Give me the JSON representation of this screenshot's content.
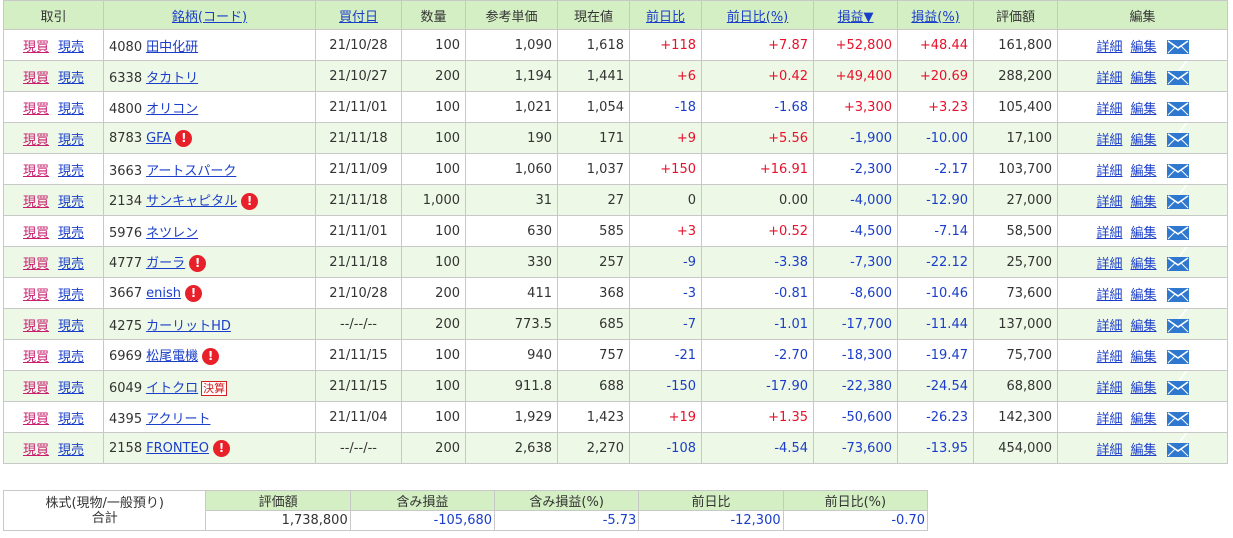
{
  "headers": {
    "trade": "取引",
    "stock": "銘柄(コード)",
    "buy_date": "買付日",
    "qty": "数量",
    "ref_price": "参考単価",
    "current": "現在値",
    "day_change": "前日比",
    "day_change_pct": "前日比(%)",
    "pl": "損益▼",
    "pl_pct": "損益(%)",
    "valuation": "評価額",
    "edit": "編集"
  },
  "labels": {
    "buy": "現買",
    "sell": "現売",
    "detail": "詳細",
    "edit": "編集",
    "alert": "!"
  },
  "rows": [
    {
      "code": "4080",
      "name": "田中化研",
      "alert": false,
      "badge": "",
      "date": "21/10/28",
      "qty": "100",
      "ref": "1,090",
      "cur": "1,618",
      "chg": "+118",
      "chg_pct": "+7.87",
      "pl": "+52,800",
      "pl_pct": "+48.44",
      "val": "161,800"
    },
    {
      "code": "6338",
      "name": "タカトリ",
      "alert": false,
      "badge": "",
      "date": "21/10/27",
      "qty": "200",
      "ref": "1,194",
      "cur": "1,441",
      "chg": "+6",
      "chg_pct": "+0.42",
      "pl": "+49,400",
      "pl_pct": "+20.69",
      "val": "288,200"
    },
    {
      "code": "4800",
      "name": "オリコン",
      "alert": false,
      "badge": "",
      "date": "21/11/01",
      "qty": "100",
      "ref": "1,021",
      "cur": "1,054",
      "chg": "-18",
      "chg_pct": "-1.68",
      "pl": "+3,300",
      "pl_pct": "+3.23",
      "val": "105,400"
    },
    {
      "code": "8783",
      "name": "GFA",
      "alert": true,
      "badge": "",
      "date": "21/11/18",
      "qty": "100",
      "ref": "190",
      "cur": "171",
      "chg": "+9",
      "chg_pct": "+5.56",
      "pl": "-1,900",
      "pl_pct": "-10.00",
      "val": "17,100"
    },
    {
      "code": "3663",
      "name": "アートスパーク",
      "alert": false,
      "badge": "",
      "date": "21/11/09",
      "qty": "100",
      "ref": "1,060",
      "cur": "1,037",
      "chg": "+150",
      "chg_pct": "+16.91",
      "pl": "-2,300",
      "pl_pct": "-2.17",
      "val": "103,700"
    },
    {
      "code": "2134",
      "name": "サンキャピタル",
      "alert": true,
      "badge": "",
      "date": "21/11/18",
      "qty": "1,000",
      "ref": "31",
      "cur": "27",
      "chg": "0",
      "chg_pct": "0.00",
      "pl": "-4,000",
      "pl_pct": "-12.90",
      "val": "27,000"
    },
    {
      "code": "5976",
      "name": "ネツレン",
      "alert": false,
      "badge": "",
      "date": "21/11/01",
      "qty": "100",
      "ref": "630",
      "cur": "585",
      "chg": "+3",
      "chg_pct": "+0.52",
      "pl": "-4,500",
      "pl_pct": "-7.14",
      "val": "58,500"
    },
    {
      "code": "4777",
      "name": "ガーラ",
      "alert": true,
      "badge": "",
      "date": "21/11/18",
      "qty": "100",
      "ref": "330",
      "cur": "257",
      "chg": "-9",
      "chg_pct": "-3.38",
      "pl": "-7,300",
      "pl_pct": "-22.12",
      "val": "25,700"
    },
    {
      "code": "3667",
      "name": "enish",
      "alert": true,
      "badge": "",
      "date": "21/10/28",
      "qty": "200",
      "ref": "411",
      "cur": "368",
      "chg": "-3",
      "chg_pct": "-0.81",
      "pl": "-8,600",
      "pl_pct": "-10.46",
      "val": "73,600"
    },
    {
      "code": "4275",
      "name": "カーリットHD",
      "alert": false,
      "badge": "",
      "date": "--/--/--",
      "qty": "200",
      "ref": "773.5",
      "cur": "685",
      "chg": "-7",
      "chg_pct": "-1.01",
      "pl": "-17,700",
      "pl_pct": "-11.44",
      "val": "137,000"
    },
    {
      "code": "6969",
      "name": "松尾電機",
      "alert": true,
      "badge": "",
      "date": "21/11/15",
      "qty": "100",
      "ref": "940",
      "cur": "757",
      "chg": "-21",
      "chg_pct": "-2.70",
      "pl": "-18,300",
      "pl_pct": "-19.47",
      "val": "75,700"
    },
    {
      "code": "6049",
      "name": "イトクロ",
      "alert": false,
      "badge": "決算",
      "date": "21/11/15",
      "qty": "100",
      "ref": "911.8",
      "cur": "688",
      "chg": "-150",
      "chg_pct": "-17.90",
      "pl": "-22,380",
      "pl_pct": "-24.54",
      "val": "68,800"
    },
    {
      "code": "4395",
      "name": "アクリート",
      "alert": false,
      "badge": "",
      "date": "21/11/04",
      "qty": "100",
      "ref": "1,929",
      "cur": "1,423",
      "chg": "+19",
      "chg_pct": "+1.35",
      "pl": "-50,600",
      "pl_pct": "-26.23",
      "val": "142,300"
    },
    {
      "code": "2158",
      "name": "FRONTEO",
      "alert": true,
      "badge": "",
      "date": "--/--/--",
      "qty": "200",
      "ref": "2,638",
      "cur": "2,270",
      "chg": "-108",
      "chg_pct": "-4.54",
      "pl": "-73,600",
      "pl_pct": "-13.95",
      "val": "454,000"
    }
  ],
  "summary": {
    "label_line1": "株式(現物/一般預り)",
    "label_line2": "合計",
    "headers": [
      "評価額",
      "含み損益",
      "含み損益(%)",
      "前日比",
      "前日比(%)"
    ],
    "values": [
      "1,738,800",
      "-105,680",
      "-5.73",
      "-12,300",
      "-0.70"
    ]
  },
  "colors": {
    "header_bg": "#d5efc4",
    "row_alt_bg": "#eef8e7",
    "positive": "#e8102a",
    "negative": "#1a3ec9",
    "link": "#1a3ec9",
    "buy_link": "#c81e6e"
  },
  "icons": {
    "alert": "exclamation-circle-icon",
    "mail": "envelope-icon"
  }
}
